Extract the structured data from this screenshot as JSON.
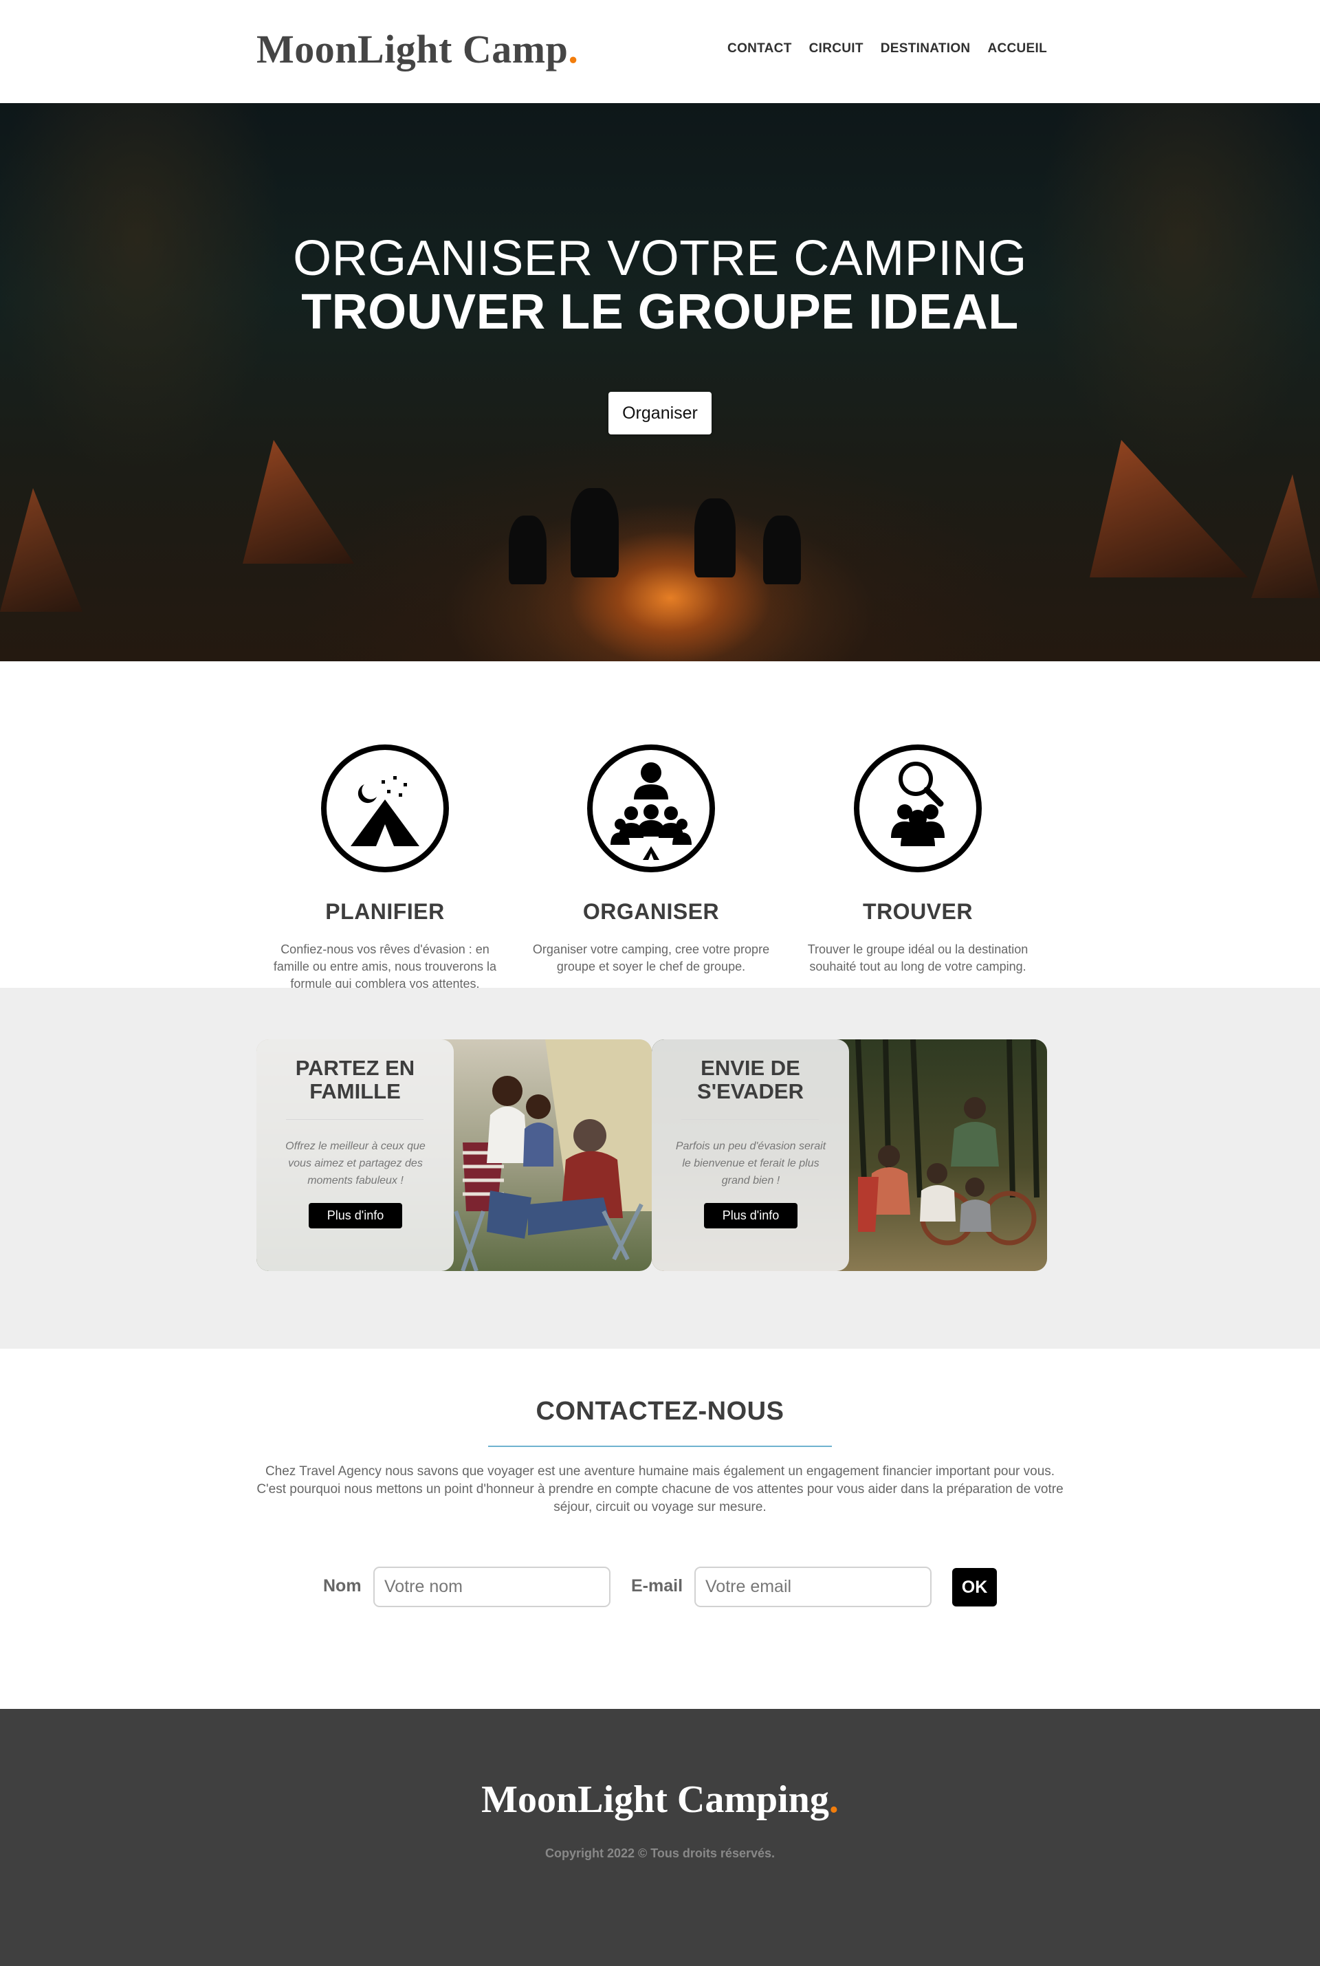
{
  "header": {
    "logo_text": "MoonLight Camp",
    "logo_dot": ".",
    "nav": [
      "CONTACT",
      "CIRCUIT",
      "DESTINATION",
      "ACCUEIL"
    ]
  },
  "hero": {
    "line1": "ORGANISER VOTRE CAMPING",
    "line2": "TROUVER LE GROUPE IDEAL",
    "cta_label": "Organiser"
  },
  "features": [
    {
      "icon": "tent-moon-icon",
      "title": "PLANIFIER",
      "text": "Confiez-nous vos rêves d'évasion : en famille ou entre amis, nous trouverons la formule qui comblera vos attentes."
    },
    {
      "icon": "group-leader-icon",
      "title": "ORGANISER",
      "text": "Organiser votre camping, cree votre propre groupe et soyer le chef de groupe."
    },
    {
      "icon": "search-group-icon",
      "title": "TROUVER",
      "text": "Trouver le groupe idéal ou la destination souhaité tout au long de votre camping."
    }
  ],
  "cards": [
    {
      "title": "PARTEZ EN FAMILLE",
      "text": "Offrez le meilleur à ceux que vous aimez et partagez des moments fabuleux !",
      "button": "Plus d'info",
      "image": "family-camping-photo"
    },
    {
      "title": "ENVIE DE S'EVADER",
      "text": "Parfois un peu d'évasion serait le bienvenue et ferait le plus grand bien !",
      "button": "Plus d'info",
      "image": "friends-camping-photo"
    }
  ],
  "contact": {
    "title": "CONTACTEZ-NOUS",
    "text": "Chez Travel Agency nous savons que voyager est une aventure humaine mais également un engagement financier important pour vous. C'est pourquoi nous mettons un point d'honneur à prendre en compte chacune de vos attentes pour vous aider dans la préparation de votre séjour, circuit ou voyage sur mesure.",
    "name_label": "Nom",
    "name_placeholder": "Votre nom",
    "email_label": "E-mail",
    "email_placeholder": "Votre email",
    "submit_label": "OK"
  },
  "footer": {
    "logo_text": "MoonLight Camping",
    "logo_dot": ".",
    "copyright": "Copyright 2022 © Tous droits réservés."
  },
  "colors": {
    "accent": "#f27d0c",
    "footer_bg": "#404040",
    "band_bg": "#eeeeee",
    "rule": "#6fb3cf"
  }
}
